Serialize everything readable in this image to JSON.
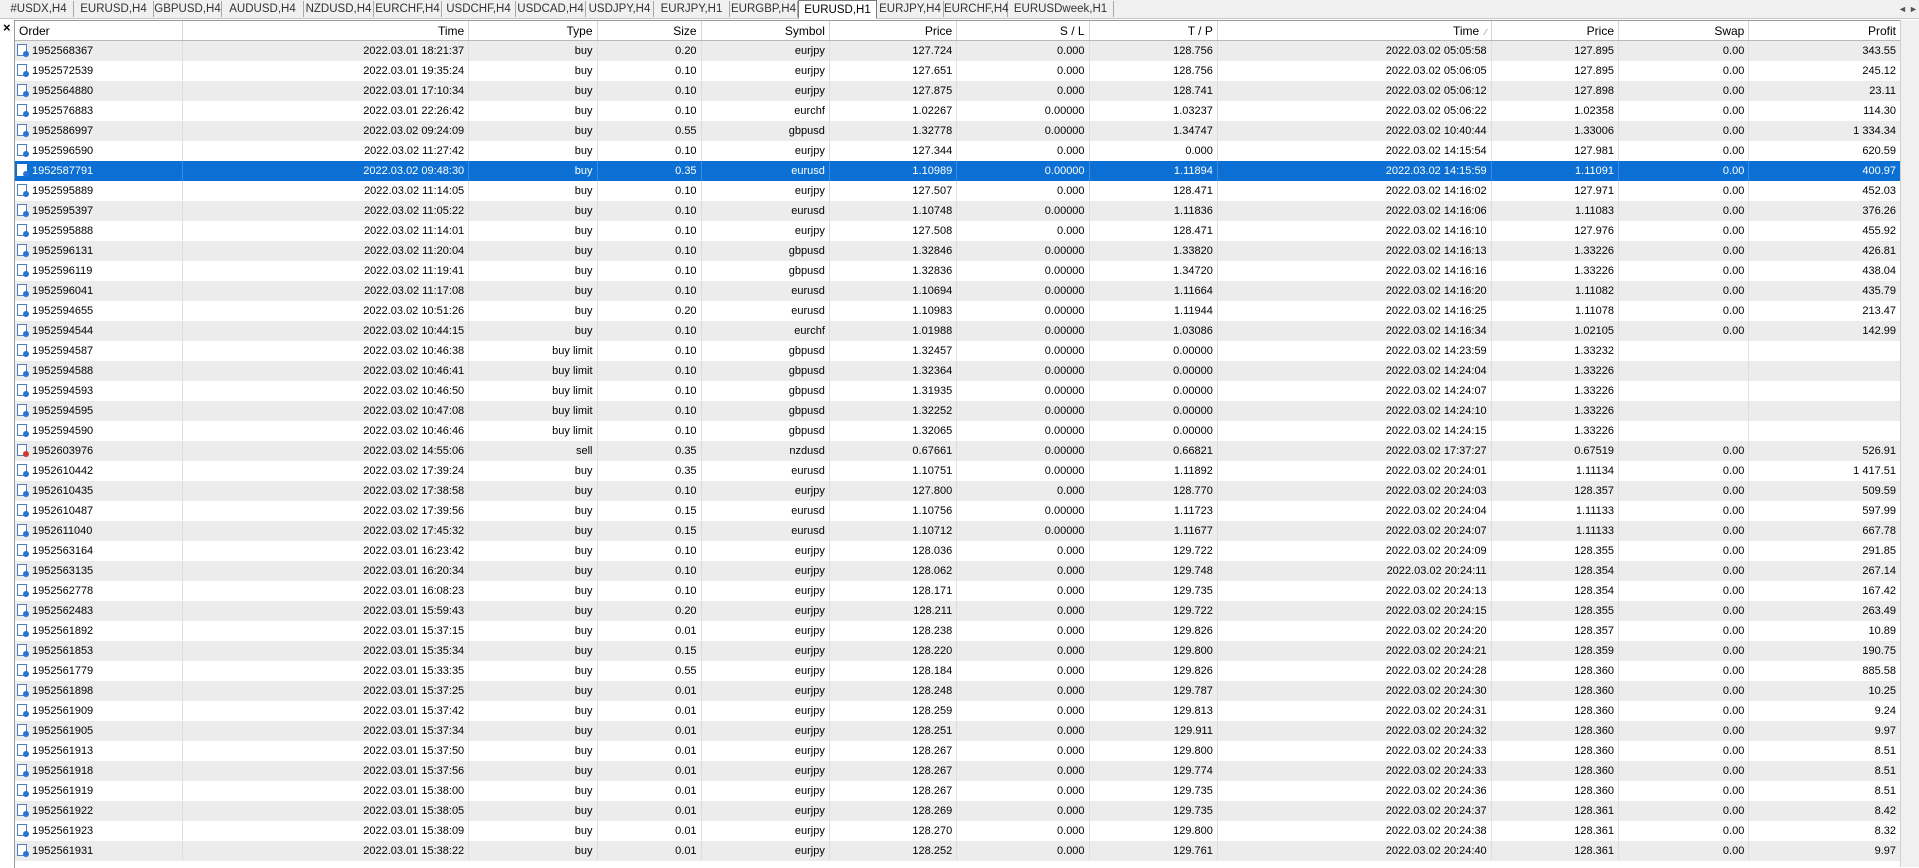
{
  "tabs": [
    "#USDX,H4",
    "EURUSD,H4",
    "GBPUSD,H4",
    "AUDUSD,H4",
    "NZDUSD,H4",
    "EURCHF,H4",
    "USDCHF,H4",
    "USDCAD,H4",
    "USDJPY,H4",
    "EURJPY,H1",
    "EURGBP,H4",
    "EURUSD,H1",
    "EURJPY,H4",
    "EURCHF,H4",
    "EURUSDweek,H1"
  ],
  "active_tab": "EURUSD,H1",
  "close_symbol": "×",
  "scroll_left": "◄",
  "scroll_right": "►",
  "columns": [
    "Order",
    "Time",
    "Type",
    "Size",
    "Symbol",
    "Price",
    "S / L",
    "T / P",
    "Time",
    "Price",
    "Swap",
    "Profit"
  ],
  "sort_indicator": "∕",
  "selected_order": "1952587791",
  "rows": [
    [
      "1952568367",
      "2022.03.01 18:21:37",
      "buy",
      "0.20",
      "eurjpy",
      "127.724",
      "0.000",
      "128.756",
      "2022.03.02 05:05:58",
      "127.895",
      "0.00",
      "343.55"
    ],
    [
      "1952572539",
      "2022.03.01 19:35:24",
      "buy",
      "0.10",
      "eurjpy",
      "127.651",
      "0.000",
      "128.756",
      "2022.03.02 05:06:05",
      "127.895",
      "0.00",
      "245.12"
    ],
    [
      "1952564880",
      "2022.03.01 17:10:34",
      "buy",
      "0.10",
      "eurjpy",
      "127.875",
      "0.000",
      "128.741",
      "2022.03.02 05:06:12",
      "127.898",
      "0.00",
      "23.11"
    ],
    [
      "1952576883",
      "2022.03.01 22:26:42",
      "buy",
      "0.10",
      "eurchf",
      "1.02267",
      "0.00000",
      "1.03237",
      "2022.03.02 05:06:22",
      "1.02358",
      "0.00",
      "114.30"
    ],
    [
      "1952586997",
      "2022.03.02 09:24:09",
      "buy",
      "0.55",
      "gbpusd",
      "1.32778",
      "0.00000",
      "1.34747",
      "2022.03.02 10:40:44",
      "1.33006",
      "0.00",
      "1 334.34"
    ],
    [
      "1952596590",
      "2022.03.02 11:27:42",
      "buy",
      "0.10",
      "eurjpy",
      "127.344",
      "0.000",
      "0.000",
      "2022.03.02 14:15:54",
      "127.981",
      "0.00",
      "620.59"
    ],
    [
      "1952587791",
      "2022.03.02 09:48:30",
      "buy",
      "0.35",
      "eurusd",
      "1.10989",
      "0.00000",
      "1.11894",
      "2022.03.02 14:15:59",
      "1.11091",
      "0.00",
      "400.97"
    ],
    [
      "1952595889",
      "2022.03.02 11:14:05",
      "buy",
      "0.10",
      "eurjpy",
      "127.507",
      "0.000",
      "128.471",
      "2022.03.02 14:16:02",
      "127.971",
      "0.00",
      "452.03"
    ],
    [
      "1952595397",
      "2022.03.02 11:05:22",
      "buy",
      "0.10",
      "eurusd",
      "1.10748",
      "0.00000",
      "1.11836",
      "2022.03.02 14:16:06",
      "1.11083",
      "0.00",
      "376.26"
    ],
    [
      "1952595888",
      "2022.03.02 11:14:01",
      "buy",
      "0.10",
      "eurjpy",
      "127.508",
      "0.000",
      "128.471",
      "2022.03.02 14:16:10",
      "127.976",
      "0.00",
      "455.92"
    ],
    [
      "1952596131",
      "2022.03.02 11:20:04",
      "buy",
      "0.10",
      "gbpusd",
      "1.32846",
      "0.00000",
      "1.33820",
      "2022.03.02 14:16:13",
      "1.33226",
      "0.00",
      "426.81"
    ],
    [
      "1952596119",
      "2022.03.02 11:19:41",
      "buy",
      "0.10",
      "gbpusd",
      "1.32836",
      "0.00000",
      "1.34720",
      "2022.03.02 14:16:16",
      "1.33226",
      "0.00",
      "438.04"
    ],
    [
      "1952596041",
      "2022.03.02 11:17:08",
      "buy",
      "0.10",
      "eurusd",
      "1.10694",
      "0.00000",
      "1.11664",
      "2022.03.02 14:16:20",
      "1.11082",
      "0.00",
      "435.79"
    ],
    [
      "1952594655",
      "2022.03.02 10:51:26",
      "buy",
      "0.20",
      "eurusd",
      "1.10983",
      "0.00000",
      "1.11944",
      "2022.03.02 14:16:25",
      "1.11078",
      "0.00",
      "213.47"
    ],
    [
      "1952594544",
      "2022.03.02 10:44:15",
      "buy",
      "0.10",
      "eurchf",
      "1.01988",
      "0.00000",
      "1.03086",
      "2022.03.02 14:16:34",
      "1.02105",
      "0.00",
      "142.99"
    ],
    [
      "1952594587",
      "2022.03.02 10:46:38",
      "buy limit",
      "0.10",
      "gbpusd",
      "1.32457",
      "0.00000",
      "0.00000",
      "2022.03.02 14:23:59",
      "1.33232",
      "",
      ""
    ],
    [
      "1952594588",
      "2022.03.02 10:46:41",
      "buy limit",
      "0.10",
      "gbpusd",
      "1.32364",
      "0.00000",
      "0.00000",
      "2022.03.02 14:24:04",
      "1.33226",
      "",
      ""
    ],
    [
      "1952594593",
      "2022.03.02 10:46:50",
      "buy limit",
      "0.10",
      "gbpusd",
      "1.31935",
      "0.00000",
      "0.00000",
      "2022.03.02 14:24:07",
      "1.33226",
      "",
      ""
    ],
    [
      "1952594595",
      "2022.03.02 10:47:08",
      "buy limit",
      "0.10",
      "gbpusd",
      "1.32252",
      "0.00000",
      "0.00000",
      "2022.03.02 14:24:10",
      "1.33226",
      "",
      ""
    ],
    [
      "1952594590",
      "2022.03.02 10:46:46",
      "buy limit",
      "0.10",
      "gbpusd",
      "1.32065",
      "0.00000",
      "0.00000",
      "2022.03.02 14:24:15",
      "1.33226",
      "",
      ""
    ],
    [
      "1952603976",
      "2022.03.02 14:55:06",
      "sell",
      "0.35",
      "nzdusd",
      "0.67661",
      "0.00000",
      "0.66821",
      "2022.03.02 17:37:27",
      "0.67519",
      "0.00",
      "526.91"
    ],
    [
      "1952610442",
      "2022.03.02 17:39:24",
      "buy",
      "0.35",
      "eurusd",
      "1.10751",
      "0.00000",
      "1.11892",
      "2022.03.02 20:24:01",
      "1.11134",
      "0.00",
      "1 417.51"
    ],
    [
      "1952610435",
      "2022.03.02 17:38:58",
      "buy",
      "0.10",
      "eurjpy",
      "127.800",
      "0.000",
      "128.770",
      "2022.03.02 20:24:03",
      "128.357",
      "0.00",
      "509.59"
    ],
    [
      "1952610487",
      "2022.03.02 17:39:56",
      "buy",
      "0.15",
      "eurusd",
      "1.10756",
      "0.00000",
      "1.11723",
      "2022.03.02 20:24:04",
      "1.11133",
      "0.00",
      "597.99"
    ],
    [
      "1952611040",
      "2022.03.02 17:45:32",
      "buy",
      "0.15",
      "eurusd",
      "1.10712",
      "0.00000",
      "1.11677",
      "2022.03.02 20:24:07",
      "1.11133",
      "0.00",
      "667.78"
    ],
    [
      "1952563164",
      "2022.03.01 16:23:42",
      "buy",
      "0.10",
      "eurjpy",
      "128.036",
      "0.000",
      "129.722",
      "2022.03.02 20:24:09",
      "128.355",
      "0.00",
      "291.85"
    ],
    [
      "1952563135",
      "2022.03.01 16:20:34",
      "buy",
      "0.10",
      "eurjpy",
      "128.062",
      "0.000",
      "129.748",
      "2022.03.02 20:24:11",
      "128.354",
      "0.00",
      "267.14"
    ],
    [
      "1952562778",
      "2022.03.01 16:08:23",
      "buy",
      "0.10",
      "eurjpy",
      "128.171",
      "0.000",
      "129.735",
      "2022.03.02 20:24:13",
      "128.354",
      "0.00",
      "167.42"
    ],
    [
      "1952562483",
      "2022.03.01 15:59:43",
      "buy",
      "0.20",
      "eurjpy",
      "128.211",
      "0.000",
      "129.722",
      "2022.03.02 20:24:15",
      "128.355",
      "0.00",
      "263.49"
    ],
    [
      "1952561892",
      "2022.03.01 15:37:15",
      "buy",
      "0.01",
      "eurjpy",
      "128.238",
      "0.000",
      "129.826",
      "2022.03.02 20:24:20",
      "128.357",
      "0.00",
      "10.89"
    ],
    [
      "1952561853",
      "2022.03.01 15:35:34",
      "buy",
      "0.15",
      "eurjpy",
      "128.220",
      "0.000",
      "129.800",
      "2022.03.02 20:24:21",
      "128.359",
      "0.00",
      "190.75"
    ],
    [
      "1952561779",
      "2022.03.01 15:33:35",
      "buy",
      "0.55",
      "eurjpy",
      "128.184",
      "0.000",
      "129.826",
      "2022.03.02 20:24:28",
      "128.360",
      "0.00",
      "885.58"
    ],
    [
      "1952561898",
      "2022.03.01 15:37:25",
      "buy",
      "0.01",
      "eurjpy",
      "128.248",
      "0.000",
      "129.787",
      "2022.03.02 20:24:30",
      "128.360",
      "0.00",
      "10.25"
    ],
    [
      "1952561909",
      "2022.03.01 15:37:42",
      "buy",
      "0.01",
      "eurjpy",
      "128.259",
      "0.000",
      "129.813",
      "2022.03.02 20:24:31",
      "128.360",
      "0.00",
      "9.24"
    ],
    [
      "1952561905",
      "2022.03.01 15:37:34",
      "buy",
      "0.01",
      "eurjpy",
      "128.251",
      "0.000",
      "129.911",
      "2022.03.02 20:24:32",
      "128.360",
      "0.00",
      "9.97"
    ],
    [
      "1952561913",
      "2022.03.01 15:37:50",
      "buy",
      "0.01",
      "eurjpy",
      "128.267",
      "0.000",
      "129.800",
      "2022.03.02 20:24:33",
      "128.360",
      "0.00",
      "8.51"
    ],
    [
      "1952561918",
      "2022.03.01 15:37:56",
      "buy",
      "0.01",
      "eurjpy",
      "128.267",
      "0.000",
      "129.774",
      "2022.03.02 20:24:33",
      "128.360",
      "0.00",
      "8.51"
    ],
    [
      "1952561919",
      "2022.03.01 15:38:00",
      "buy",
      "0.01",
      "eurjpy",
      "128.267",
      "0.000",
      "129.735",
      "2022.03.02 20:24:36",
      "128.360",
      "0.00",
      "8.51"
    ],
    [
      "1952561922",
      "2022.03.01 15:38:05",
      "buy",
      "0.01",
      "eurjpy",
      "128.269",
      "0.000",
      "129.735",
      "2022.03.02 20:24:37",
      "128.361",
      "0.00",
      "8.42"
    ],
    [
      "1952561923",
      "2022.03.01 15:38:09",
      "buy",
      "0.01",
      "eurjpy",
      "128.270",
      "0.000",
      "129.800",
      "2022.03.02 20:24:38",
      "128.361",
      "0.00",
      "8.32"
    ],
    [
      "1952561931",
      "2022.03.01 15:38:22",
      "buy",
      "0.01",
      "eurjpy",
      "128.252",
      "0.000",
      "129.761",
      "2022.03.02 20:24:40",
      "128.361",
      "0.00",
      "9.97"
    ]
  ]
}
